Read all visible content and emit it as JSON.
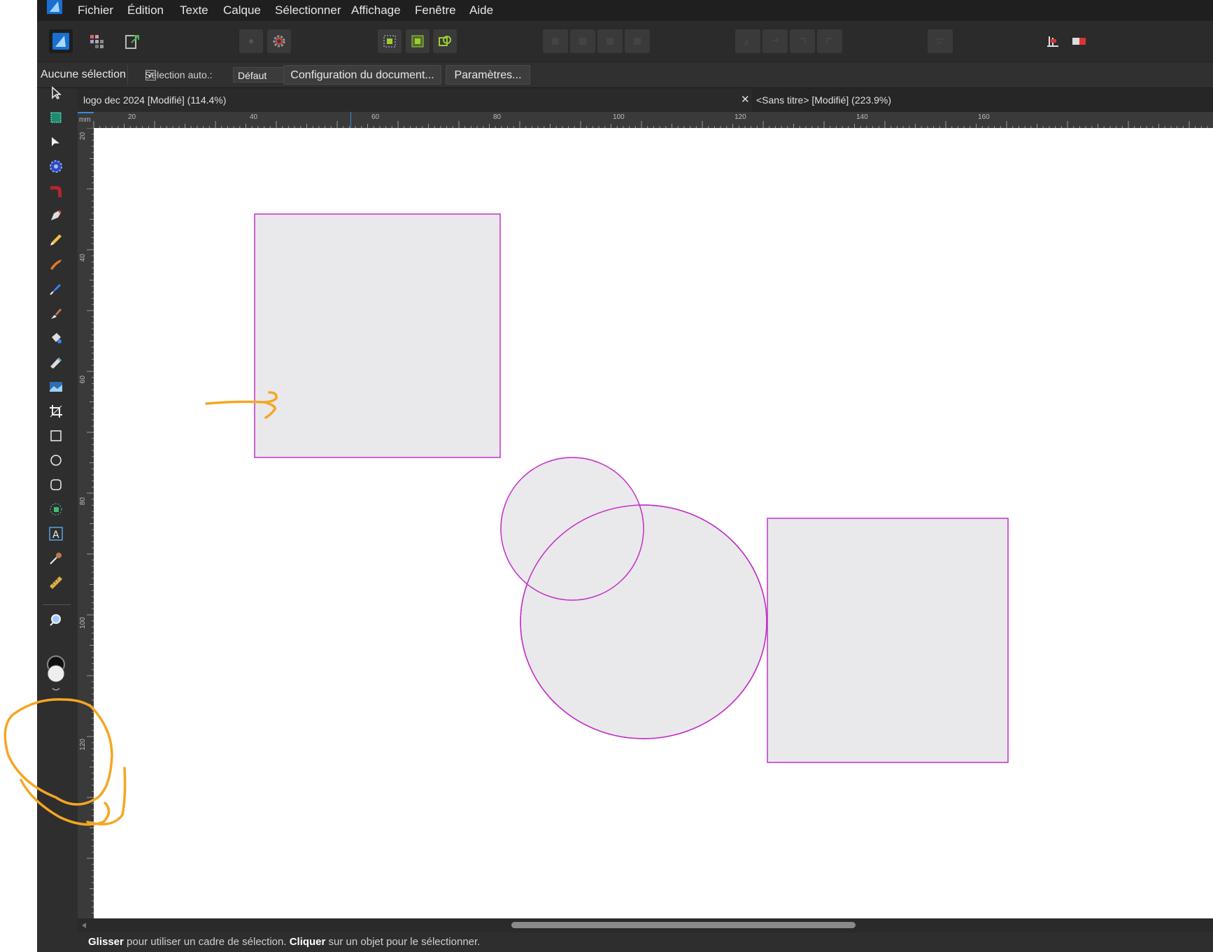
{
  "menu": {
    "items": [
      "Fichier",
      "Édition",
      "Texte",
      "Calque",
      "Sélectionner",
      "Affichage",
      "Fenêtre",
      "Aide"
    ]
  },
  "context_bar": {
    "selection_status": "Aucune sélection",
    "auto_select_checked": true,
    "auto_select_label": "Sélection auto.:",
    "auto_select_value": "Défaut",
    "doc_setup_button": "Configuration du document...",
    "preferences_button": "Paramètres..."
  },
  "tabs": [
    {
      "label": "logo dec 2024 [Modifié] (114.4%)",
      "active": true
    },
    {
      "label": "<Sans titre> [Modifié] (223.9%)",
      "active": false
    }
  ],
  "tab_close_glyph": "✕",
  "ruler": {
    "unit": "mm",
    "top_labels": [
      "20",
      "40",
      "60",
      "80",
      "100",
      "120",
      "140",
      "160"
    ],
    "left_labels": [
      "20",
      "40",
      "60",
      "80",
      "100",
      "120"
    ]
  },
  "tools": [
    "move-tool-icon",
    "artboard-tool-icon",
    "node-tool-icon",
    "contour-tool-icon",
    "corner-tool-icon",
    "pen-tool-icon",
    "pencil-tool-icon",
    "vector-brush-tool-icon",
    "fill-tool-icon",
    "paint-brush-icon",
    "flood-fill-icon",
    "transparency-tool-icon",
    "place-image-icon",
    "crop-tool-icon",
    "rectangle-tool-icon",
    "ellipse-tool-icon",
    "rounded-rectangle-tool-icon",
    "shape-builder-icon",
    "artistic-text-tool-icon",
    "color-picker-icon",
    "measure-tool-icon",
    "zoom-tool-icon"
  ],
  "status_bar": {
    "drag_word": "Glisser",
    "drag_text": " pour utiliser un cadre de sélection. ",
    "click_word": "Cliquer",
    "click_text": " sur un objet pour le sélectionner."
  },
  "colors": {
    "shape_fill": "#e9e8ea",
    "shape_stroke": "#c230c8",
    "annotation": "#f5a623",
    "accent": "#2f7fd6"
  }
}
